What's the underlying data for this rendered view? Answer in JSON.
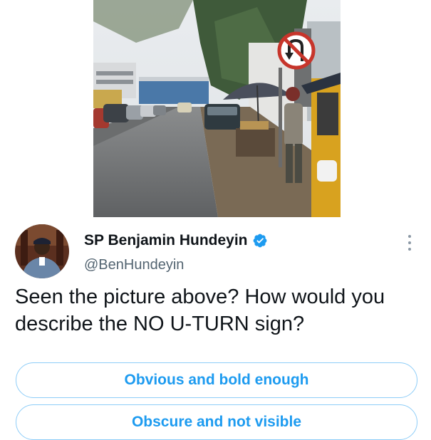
{
  "tweet": {
    "author_name": "SP Benjamin Hundeyin",
    "handle": "@BenHundeyin",
    "verified": true,
    "text": "Seen the picture above? How would you describe the NO U-TURN sign?"
  },
  "poll": {
    "options": [
      {
        "label": "Obvious and bold enough"
      },
      {
        "label": "Obscure and not visible"
      }
    ]
  },
  "photo": {
    "subject": "street with no u-turn sign"
  },
  "colors": {
    "accent": "#1d9bf0",
    "poll_border": "#8ecdf8",
    "text": "#0f1419",
    "secondary_text": "#536471"
  },
  "icons": {
    "verified": "verified-badge-icon",
    "more": "more-options-icon",
    "no_uturn": "no-u-turn-sign-icon"
  }
}
